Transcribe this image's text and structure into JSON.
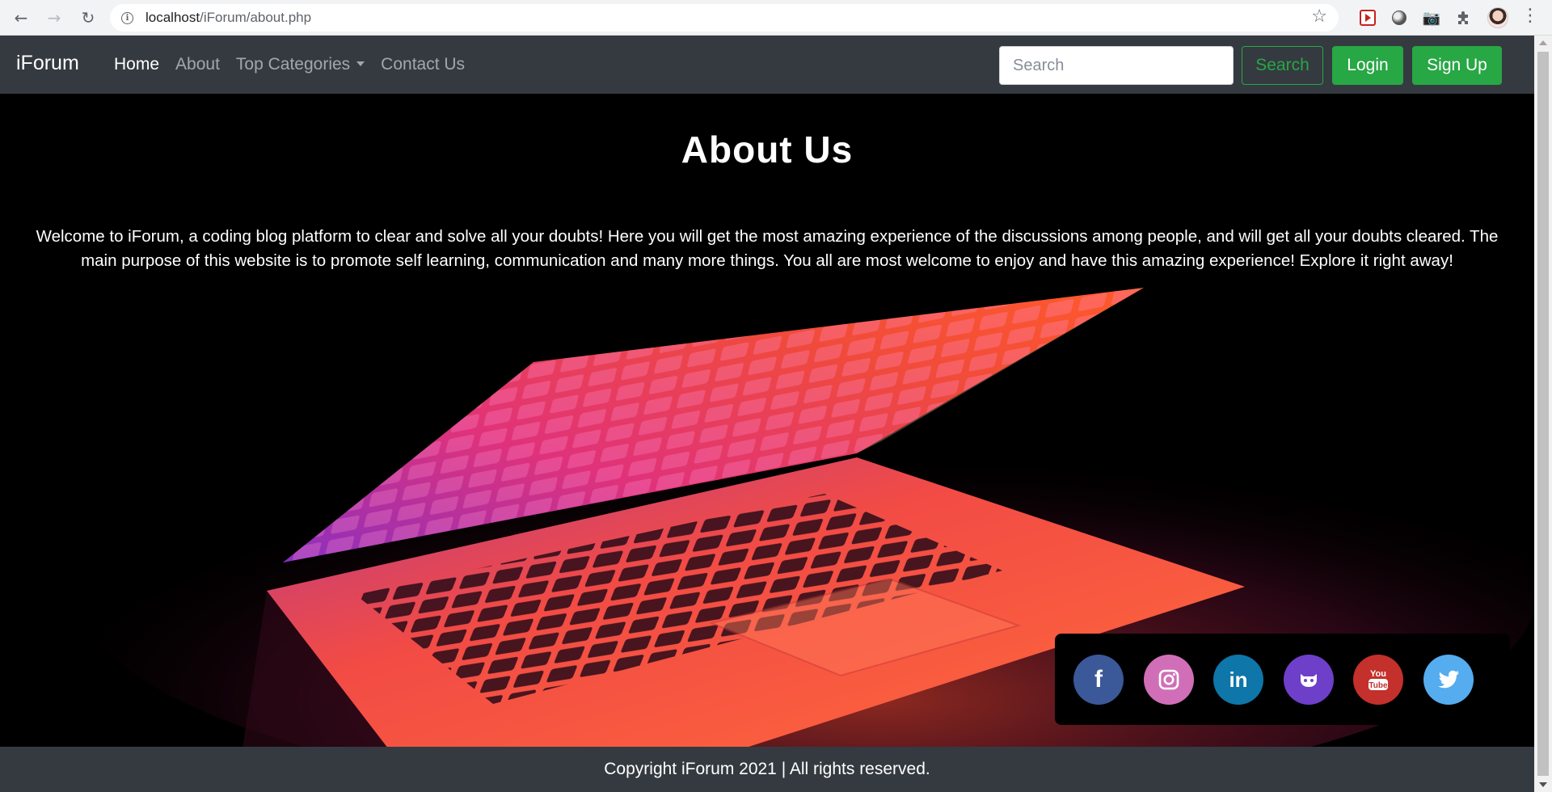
{
  "browser": {
    "url_host": "localhost",
    "url_path": "/iForum/about.php"
  },
  "navbar": {
    "brand": "iForum",
    "links": [
      {
        "label": "Home",
        "active": true
      },
      {
        "label": "About",
        "active": false
      },
      {
        "label": "Top Categories",
        "active": false,
        "dropdown": true
      },
      {
        "label": "Contact Us",
        "active": false
      }
    ],
    "search_placeholder": "Search",
    "search_button": "Search",
    "login_button": "Login",
    "signup_button": "Sign Up"
  },
  "hero": {
    "title": "About Us",
    "text": "Welcome to iForum, a coding blog platform to clear and solve all your doubts! Here you will get the most amazing experience of the discussions among people, and will get all your doubts cleared. The main purpose of this website is to promote self learning, communication and many more things. You all are most welcome to enjoy and have this amazing experience! Explore it right away!"
  },
  "social": [
    {
      "name": "facebook-icon",
      "color": "#3b5998"
    },
    {
      "name": "instagram-icon",
      "color": "#d06fb7"
    },
    {
      "name": "linkedin-icon",
      "color": "#0e76a8"
    },
    {
      "name": "github-icon",
      "color": "#6e3fc9"
    },
    {
      "name": "youtube-icon",
      "color": "#c4302b"
    },
    {
      "name": "twitter-icon",
      "color": "#55acee"
    }
  ],
  "footer": {
    "copyright": "Copyright iForum 2021 | All rights reserved."
  },
  "colors": {
    "navbar_bg": "#343a40",
    "success": "#28a745"
  }
}
